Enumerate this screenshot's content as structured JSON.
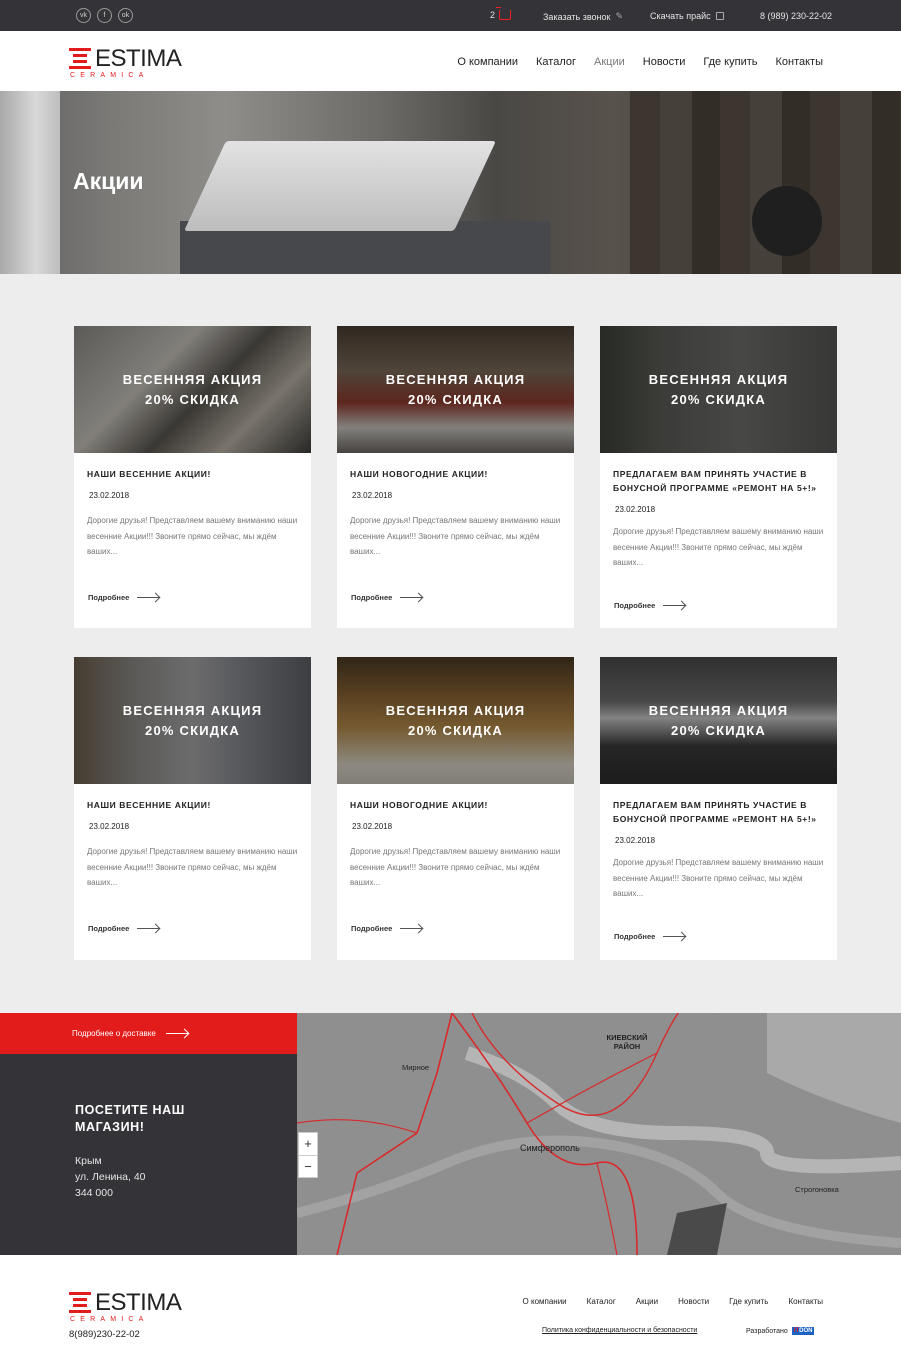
{
  "topbar": {
    "social": [
      "vk",
      "f",
      "ok"
    ],
    "cart_count": "2",
    "callback": "Заказать звонок",
    "price": "Скачать прайс",
    "phone": "8 (989) 230-22-02"
  },
  "logo": {
    "word": "ESTIMA",
    "sub": "CERAMICA"
  },
  "nav": [
    "О компании",
    "Каталог",
    "Акции",
    "Новости",
    "Где купить",
    "Контакты"
  ],
  "hero": {
    "title": "Акции"
  },
  "promo_label": [
    "ВЕСЕННЯЯ АКЦИЯ",
    "20% СКИДКА"
  ],
  "cards": [
    {
      "title": "Наши весенние акции!",
      "date": "23.02.2018",
      "text": "Дорогие друзья! Представляем вашему вниманию наши весенние Акции!!! Звоните прямо сейчас, мы ждём ваших...",
      "more": "Подробнее"
    },
    {
      "title": "Наши новогодние акции!",
      "date": "23.02.2018",
      "text": "Дорогие друзья! Представляем вашему вниманию наши весенние Акции!!! Звоните прямо сейчас, мы ждём ваших...",
      "more": "Подробнее"
    },
    {
      "title": "Предлагаем вам принять участие в бонусной программе «Ремонт на 5+!»",
      "date": "23.02.2018",
      "text": "Дорогие друзья! Представляем вашему вниманию наши весенние Акции!!! Звоните прямо сейчас, мы ждём ваших...",
      "more": "Подробнее"
    },
    {
      "title": "Наши весенние акции!",
      "date": "23.02.2018",
      "text": "Дорогие друзья! Представляем вашему вниманию наши весенние Акции!!! Звоните прямо сейчас, мы ждём ваших...",
      "more": "Подробнее"
    },
    {
      "title": "Наши новогодние акции!",
      "date": "23.02.2018",
      "text": "Дорогие друзья! Представляем вашему вниманию наши весенние Акции!!! Звоните прямо сейчас, мы ждём ваших...",
      "more": "Подробнее"
    },
    {
      "title": "Предлагаем вам принять участие в бонусной программе «Ремонт на 5+!»",
      "date": "23.02.2018",
      "text": "Дорогие друзья! Представляем вашему вниманию наши весенние Акции!!! Звоните прямо сейчас, мы ждём ваших...",
      "more": "Подробнее"
    }
  ],
  "store": {
    "delivery_link": "Подробнее о доставке",
    "heading": "ПОСЕТИТЕ НАШ МАГАЗИН!",
    "region": "Крым",
    "street": "ул. Ленина, 40",
    "zip": "344 000"
  },
  "map": {
    "labels": [
      "КИЕВСКИЙ РАЙОН",
      "Симферополь",
      "Мирное",
      "Строгоновка"
    ],
    "zoom_in": "+",
    "zoom_out": "−"
  },
  "footer": {
    "phone": "8(989)230-22-02",
    "nav": [
      "О компании",
      "Каталог",
      "Акции",
      "Новости",
      "Где купить",
      "Контакты"
    ],
    "policy": "Политика конфиденциальности и безопасности",
    "dev_label": "Разработано",
    "dev_brand_it": "IT",
    "dev_brand_don": "DON"
  },
  "colors": {
    "accent": "#e21b1b",
    "dark": "#333338",
    "bg": "#ededed"
  }
}
